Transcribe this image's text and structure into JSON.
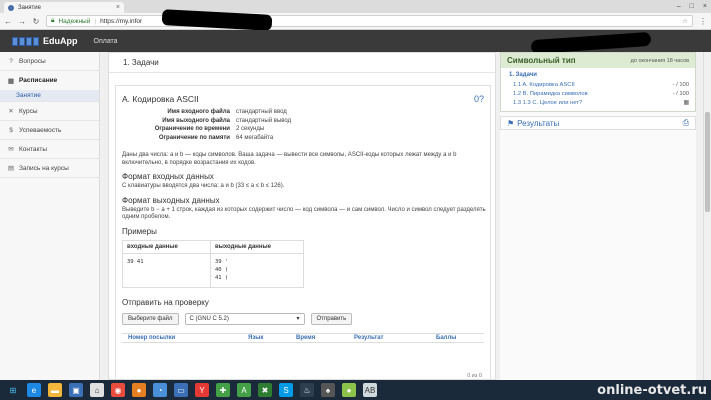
{
  "browser": {
    "tab_title": "Занятие",
    "tab_close": "×",
    "secure_label": "Надежный",
    "url": "https://my.infor",
    "win_controls": [
      "–",
      "□",
      "×"
    ]
  },
  "app": {
    "brand": "EduApp",
    "nav_payment": "Оплата"
  },
  "sidebar": {
    "items": [
      {
        "icon": "?",
        "label": "Вопросы"
      },
      {
        "icon": "▦",
        "label": "Расписание"
      },
      {
        "icon": "✕",
        "label": "Курсы"
      },
      {
        "icon": "$",
        "label": "Успеваемость"
      },
      {
        "icon": "✉",
        "label": "Контакты"
      },
      {
        "icon": "▤",
        "label": "Запись на курсы"
      }
    ],
    "sub_item": "Занятие"
  },
  "main": {
    "breadcrumb": "1. Задачи",
    "problem": {
      "title": "A. Кодировка ASCII",
      "counter": "0?",
      "limits": [
        {
          "k": "Имя входного файла",
          "v": "стандартный ввод"
        },
        {
          "k": "Имя выходного файла",
          "v": "стандартный вывод"
        },
        {
          "k": "Ограничение по времени",
          "v": "2 секунды"
        },
        {
          "k": "Ограничение по памяти",
          "v": "64 мегабайта"
        }
      ],
      "statement": "Даны два числа: a и b — коды символов. Ваша задача — вывести все символы, ASCII-коды которых лежат между a и b включительно, в порядке возрастания их кодов.",
      "input_title": "Формат входных данных",
      "input_text": "С клавиатуры вводятся два числа: a и b (33 ≤ a ≤ b ≤ 126).",
      "output_title": "Формат выходных данных",
      "output_text": "Выведите b − a + 1 строк, каждая из которых содержит число — код символа — и сам символ. Число и символ следует разделять одним пробелом.",
      "samples_title": "Примеры",
      "samples_head_in": "входные данные",
      "samples_head_out": "выходные данные",
      "sample_in": [
        "39 41"
      ],
      "sample_out": [
        "39 '",
        "40 (",
        "41 )"
      ]
    },
    "submit": {
      "title": "Отправить на проверку",
      "choose_file": "Выберите файл",
      "language": "C (GNU C 5.2)",
      "send": "Отправить"
    },
    "submissions_header": [
      "Номер посылки",
      "Язык",
      "Время",
      "Результат",
      "Баллы"
    ],
    "pager": "0 из 0"
  },
  "right": {
    "panel_title": "Символьный тип",
    "time_left": "до окончания 18 часов",
    "section": "1. Задачи",
    "tasks": [
      {
        "name": "1.1 A. Кодировка ASCII",
        "score": "- / 100"
      },
      {
        "name": "1.2 B. Пирамидка символов",
        "score": "- / 100"
      },
      {
        "name": "1.3 1.3 C. Целое или нет?",
        "score": "▦"
      }
    ],
    "results_label": "Результаты"
  },
  "taskbar": {
    "watermark": "online-otvet.ru",
    "icons": [
      {
        "name": "ie-icon",
        "glyph": "e",
        "color": "#1e88e5"
      },
      {
        "name": "folder-icon",
        "glyph": "▬",
        "color": "#f2b73a"
      },
      {
        "name": "store-icon",
        "glyph": "▣",
        "color": "#3b6fb6"
      },
      {
        "name": "home-icon",
        "glyph": "⌂",
        "color": "#e0e0e0"
      },
      {
        "name": "chrome-icon",
        "glyph": "◉",
        "color": "#e74c3c"
      },
      {
        "name": "media-icon",
        "glyph": "●",
        "color": "#e67e22"
      },
      {
        "name": "wifi-icon",
        "glyph": "◔",
        "color": "#4a90d9"
      },
      {
        "name": "mail-icon",
        "glyph": "▭",
        "color": "#3b6fb6"
      },
      {
        "name": "yandex-icon",
        "glyph": "Y",
        "color": "#e53935"
      },
      {
        "name": "maps-icon",
        "glyph": "✚",
        "color": "#43a047"
      },
      {
        "name": "text-icon",
        "glyph": "A",
        "color": "#43a047"
      },
      {
        "name": "close-app-icon",
        "glyph": "✖",
        "color": "#2e7d32"
      },
      {
        "name": "skype-icon",
        "glyph": "S",
        "color": "#039be5"
      },
      {
        "name": "steam-icon",
        "glyph": "♨",
        "color": "#2c3e50"
      },
      {
        "name": "vk-icon",
        "glyph": "♠",
        "color": "#555"
      },
      {
        "name": "chat-icon",
        "glyph": "●",
        "color": "#8bc34a"
      },
      {
        "name": "book-icon",
        "glyph": "AB",
        "color": "#cfd8dc"
      }
    ]
  }
}
